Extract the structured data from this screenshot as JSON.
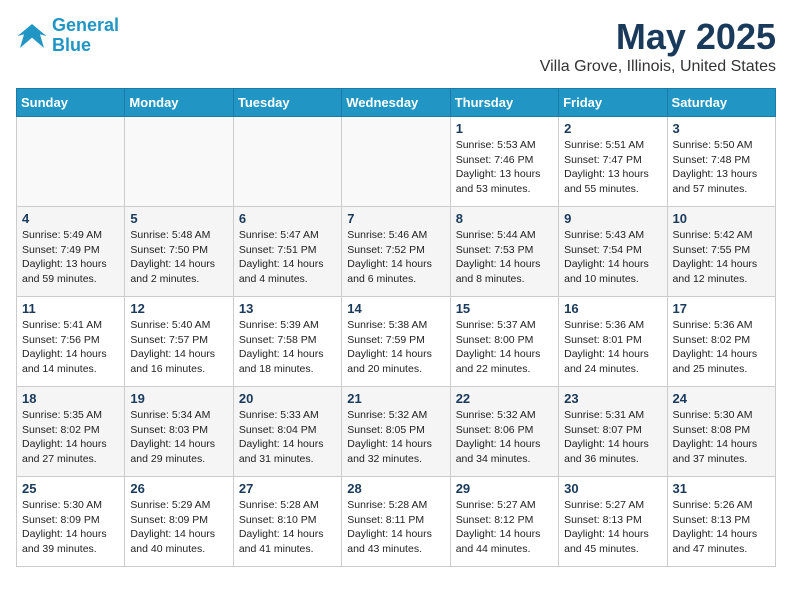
{
  "header": {
    "logo_line1": "General",
    "logo_line2": "Blue",
    "month": "May 2025",
    "location": "Villa Grove, Illinois, United States"
  },
  "weekdays": [
    "Sunday",
    "Monday",
    "Tuesday",
    "Wednesday",
    "Thursday",
    "Friday",
    "Saturday"
  ],
  "weeks": [
    [
      {
        "day": "",
        "info": ""
      },
      {
        "day": "",
        "info": ""
      },
      {
        "day": "",
        "info": ""
      },
      {
        "day": "",
        "info": ""
      },
      {
        "day": "1",
        "info": "Sunrise: 5:53 AM\nSunset: 7:46 PM\nDaylight: 13 hours\nand 53 minutes."
      },
      {
        "day": "2",
        "info": "Sunrise: 5:51 AM\nSunset: 7:47 PM\nDaylight: 13 hours\nand 55 minutes."
      },
      {
        "day": "3",
        "info": "Sunrise: 5:50 AM\nSunset: 7:48 PM\nDaylight: 13 hours\nand 57 minutes."
      }
    ],
    [
      {
        "day": "4",
        "info": "Sunrise: 5:49 AM\nSunset: 7:49 PM\nDaylight: 13 hours\nand 59 minutes."
      },
      {
        "day": "5",
        "info": "Sunrise: 5:48 AM\nSunset: 7:50 PM\nDaylight: 14 hours\nand 2 minutes."
      },
      {
        "day": "6",
        "info": "Sunrise: 5:47 AM\nSunset: 7:51 PM\nDaylight: 14 hours\nand 4 minutes."
      },
      {
        "day": "7",
        "info": "Sunrise: 5:46 AM\nSunset: 7:52 PM\nDaylight: 14 hours\nand 6 minutes."
      },
      {
        "day": "8",
        "info": "Sunrise: 5:44 AM\nSunset: 7:53 PM\nDaylight: 14 hours\nand 8 minutes."
      },
      {
        "day": "9",
        "info": "Sunrise: 5:43 AM\nSunset: 7:54 PM\nDaylight: 14 hours\nand 10 minutes."
      },
      {
        "day": "10",
        "info": "Sunrise: 5:42 AM\nSunset: 7:55 PM\nDaylight: 14 hours\nand 12 minutes."
      }
    ],
    [
      {
        "day": "11",
        "info": "Sunrise: 5:41 AM\nSunset: 7:56 PM\nDaylight: 14 hours\nand 14 minutes."
      },
      {
        "day": "12",
        "info": "Sunrise: 5:40 AM\nSunset: 7:57 PM\nDaylight: 14 hours\nand 16 minutes."
      },
      {
        "day": "13",
        "info": "Sunrise: 5:39 AM\nSunset: 7:58 PM\nDaylight: 14 hours\nand 18 minutes."
      },
      {
        "day": "14",
        "info": "Sunrise: 5:38 AM\nSunset: 7:59 PM\nDaylight: 14 hours\nand 20 minutes."
      },
      {
        "day": "15",
        "info": "Sunrise: 5:37 AM\nSunset: 8:00 PM\nDaylight: 14 hours\nand 22 minutes."
      },
      {
        "day": "16",
        "info": "Sunrise: 5:36 AM\nSunset: 8:01 PM\nDaylight: 14 hours\nand 24 minutes."
      },
      {
        "day": "17",
        "info": "Sunrise: 5:36 AM\nSunset: 8:02 PM\nDaylight: 14 hours\nand 25 minutes."
      }
    ],
    [
      {
        "day": "18",
        "info": "Sunrise: 5:35 AM\nSunset: 8:02 PM\nDaylight: 14 hours\nand 27 minutes."
      },
      {
        "day": "19",
        "info": "Sunrise: 5:34 AM\nSunset: 8:03 PM\nDaylight: 14 hours\nand 29 minutes."
      },
      {
        "day": "20",
        "info": "Sunrise: 5:33 AM\nSunset: 8:04 PM\nDaylight: 14 hours\nand 31 minutes."
      },
      {
        "day": "21",
        "info": "Sunrise: 5:32 AM\nSunset: 8:05 PM\nDaylight: 14 hours\nand 32 minutes."
      },
      {
        "day": "22",
        "info": "Sunrise: 5:32 AM\nSunset: 8:06 PM\nDaylight: 14 hours\nand 34 minutes."
      },
      {
        "day": "23",
        "info": "Sunrise: 5:31 AM\nSunset: 8:07 PM\nDaylight: 14 hours\nand 36 minutes."
      },
      {
        "day": "24",
        "info": "Sunrise: 5:30 AM\nSunset: 8:08 PM\nDaylight: 14 hours\nand 37 minutes."
      }
    ],
    [
      {
        "day": "25",
        "info": "Sunrise: 5:30 AM\nSunset: 8:09 PM\nDaylight: 14 hours\nand 39 minutes."
      },
      {
        "day": "26",
        "info": "Sunrise: 5:29 AM\nSunset: 8:09 PM\nDaylight: 14 hours\nand 40 minutes."
      },
      {
        "day": "27",
        "info": "Sunrise: 5:28 AM\nSunset: 8:10 PM\nDaylight: 14 hours\nand 41 minutes."
      },
      {
        "day": "28",
        "info": "Sunrise: 5:28 AM\nSunset: 8:11 PM\nDaylight: 14 hours\nand 43 minutes."
      },
      {
        "day": "29",
        "info": "Sunrise: 5:27 AM\nSunset: 8:12 PM\nDaylight: 14 hours\nand 44 minutes."
      },
      {
        "day": "30",
        "info": "Sunrise: 5:27 AM\nSunset: 8:13 PM\nDaylight: 14 hours\nand 45 minutes."
      },
      {
        "day": "31",
        "info": "Sunrise: 5:26 AM\nSunset: 8:13 PM\nDaylight: 14 hours\nand 47 minutes."
      }
    ]
  ]
}
